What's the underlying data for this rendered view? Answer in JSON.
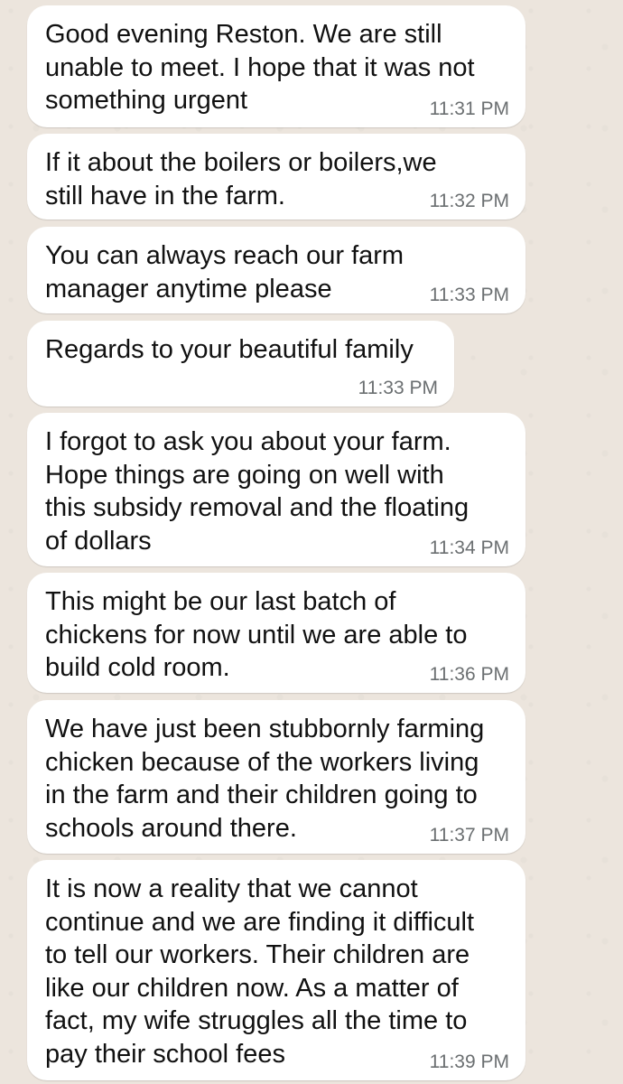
{
  "messages": [
    {
      "text": "Good evening Reston. We are still\nunable to meet. I hope that it was not\nsomething urgent",
      "time": "11:31 PM"
    },
    {
      "text": "If it about the boilers or boilers,we\nstill have in the farm.",
      "time": "11:32 PM"
    },
    {
      "text": "You can always reach our farm\nmanager anytime please",
      "time": "11:33 PM"
    },
    {
      "text": "Regards to your beautiful family",
      "time": "11:33 PM"
    },
    {
      "text": "I forgot to ask you about your farm.\nHope things are going on well with\nthis subsidy removal and the floating\nof dollars",
      "time": "11:34 PM"
    },
    {
      "text": "This might be our last batch of\nchickens for now until we are able to\nbuild cold room.",
      "time": "11:36 PM"
    },
    {
      "text": "We have just been stubbornly farming\nchicken because of the workers living\nin the farm and their children going to\nschools around there.",
      "time": "11:37 PM"
    },
    {
      "text": "It is now a reality that we cannot\ncontinue and we are finding it difficult\nto tell our workers. Their children are\nlike our children now. As a matter of\nfact, my wife struggles all the time to\npay their school fees",
      "time": "11:39 PM"
    }
  ]
}
